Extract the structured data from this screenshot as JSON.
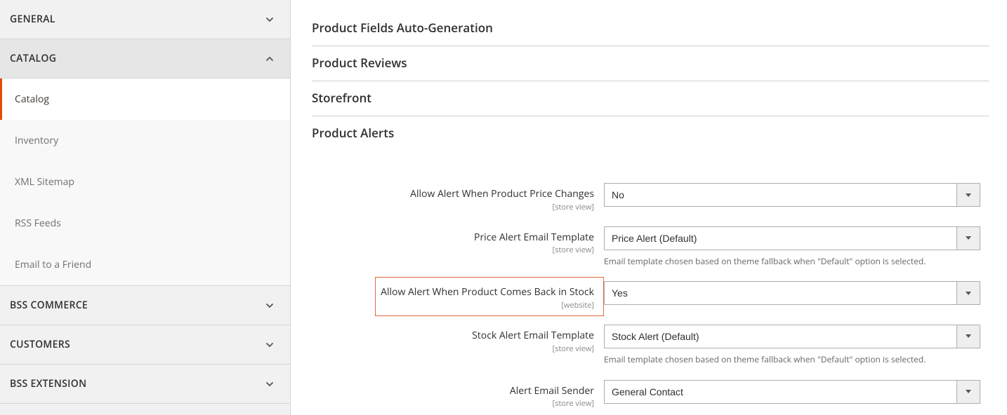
{
  "sidebar": {
    "sections": [
      {
        "label": "GENERAL",
        "expanded": false
      },
      {
        "label": "CATALOG",
        "expanded": true,
        "items": [
          {
            "label": "Catalog",
            "active": true
          },
          {
            "label": "Inventory"
          },
          {
            "label": "XML Sitemap"
          },
          {
            "label": "RSS Feeds"
          },
          {
            "label": "Email to a Friend"
          }
        ]
      },
      {
        "label": "BSS COMMERCE",
        "expanded": false
      },
      {
        "label": "CUSTOMERS",
        "expanded": false
      },
      {
        "label": "BSS EXTENSION",
        "expanded": false
      }
    ]
  },
  "main": {
    "sections": [
      "Product Fields Auto-Generation",
      "Product Reviews",
      "Storefront",
      "Product Alerts"
    ],
    "fields": {
      "allow_price": {
        "label": "Allow Alert When Product Price Changes",
        "scope": "[store view]",
        "value": "No"
      },
      "price_template": {
        "label": "Price Alert Email Template",
        "scope": "[store view]",
        "value": "Price Alert (Default)",
        "note": "Email template chosen based on theme fallback when \"Default\" option is selected."
      },
      "allow_stock": {
        "label": "Allow Alert When Product Comes Back in Stock",
        "scope": "[website]",
        "value": "Yes"
      },
      "stock_template": {
        "label": "Stock Alert Email Template",
        "scope": "[store view]",
        "value": "Stock Alert (Default)",
        "note": "Email template chosen based on theme fallback when \"Default\" option is selected."
      },
      "sender": {
        "label": "Alert Email Sender",
        "scope": "[store view]",
        "value": "General Contact"
      }
    }
  }
}
